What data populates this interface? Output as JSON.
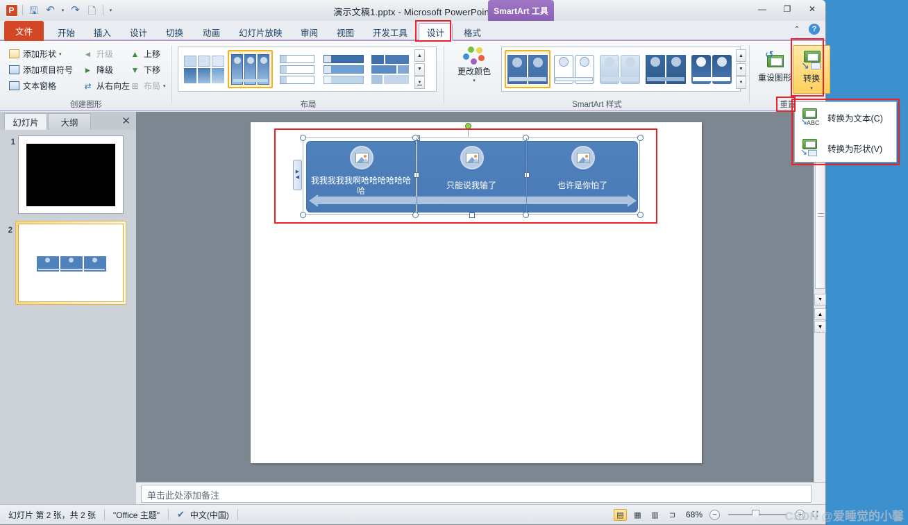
{
  "window": {
    "title": "演示文稿1.pptx  -  Microsoft PowerPoint",
    "context_tab_label": "SmartArt 工具",
    "minimize": "—",
    "restore": "❐",
    "close": "✕",
    "ribbon_collapse": "⌃",
    "help": "?"
  },
  "quick_access": {
    "logo": "P",
    "items": [
      {
        "name": "save-icon",
        "glyph": "🖫"
      },
      {
        "name": "undo-icon",
        "glyph": "↶"
      },
      {
        "name": "undo-dropdown-icon",
        "glyph": "▾"
      },
      {
        "name": "redo-icon",
        "glyph": "↷"
      },
      {
        "name": "new-icon",
        "glyph": "🗋"
      },
      {
        "name": "customize-qat-icon",
        "glyph": "▾"
      }
    ]
  },
  "tabs": [
    {
      "label": "文件",
      "kind": "file"
    },
    {
      "label": "开始"
    },
    {
      "label": "插入"
    },
    {
      "label": "设计"
    },
    {
      "label": "切换"
    },
    {
      "label": "动画"
    },
    {
      "label": "幻灯片放映"
    },
    {
      "label": "审阅"
    },
    {
      "label": "视图"
    },
    {
      "label": "开发工具"
    },
    {
      "label": "设计",
      "active": true,
      "highlighted": true
    },
    {
      "label": "格式"
    }
  ],
  "ribbon": {
    "groups": [
      {
        "name": "create-graphic",
        "label": "创建图形",
        "commands": [
          {
            "label": "添加形状",
            "icon": "add-shape-icon",
            "dropdown": true,
            "dimmed": false
          },
          {
            "label": "升级",
            "icon": "promote-icon",
            "dimmed": true
          },
          {
            "label": "上移",
            "icon": "move-up-icon",
            "dimmed": false
          },
          {
            "label": "添加项目符号",
            "icon": "add-bullet-icon",
            "dimmed": false
          },
          {
            "label": "降级",
            "icon": "demote-icon",
            "dimmed": false
          },
          {
            "label": "下移",
            "icon": "move-down-icon",
            "dimmed": false
          },
          {
            "label": "文本窗格",
            "icon": "text-pane-icon",
            "dimmed": false
          },
          {
            "label": "从右向左",
            "icon": "right-to-left-icon",
            "dimmed": false
          },
          {
            "label": "布局",
            "icon": "layout-icon",
            "dropdown": true,
            "dimmed": true
          }
        ]
      },
      {
        "name": "layouts",
        "label": "布局",
        "gallery_selected_index": 1,
        "scroll_up": "▲",
        "scroll_down": "▼",
        "more": "▼"
      },
      {
        "name": "smartart-styles",
        "label": "SmartArt 样式",
        "change_colors_label": "更改颜色",
        "gallery_selected_index": 0,
        "scroll_up": "▲",
        "scroll_down": "▼",
        "more": "▼"
      },
      {
        "name": "reset",
        "label": "重置",
        "buttons": [
          {
            "label": "重设图形",
            "icon": "reset-graphic-icon",
            "selected": false
          },
          {
            "label": "转换",
            "icon": "convert-icon",
            "selected": true,
            "dropdown": "▾"
          }
        ]
      }
    ]
  },
  "convert_menu": {
    "items": [
      {
        "label": "转换为文本(C)",
        "accel": "C",
        "icon": "convert-to-text-icon"
      },
      {
        "label": "转换为形状(V)",
        "accel": "V",
        "icon": "convert-to-shapes-icon"
      }
    ]
  },
  "left_panel": {
    "tabs": [
      {
        "label": "幻灯片",
        "active": true
      },
      {
        "label": "大纲",
        "active": false
      }
    ],
    "close_label": "✕",
    "slides": [
      {
        "number": "1",
        "selected": false,
        "content": "black"
      },
      {
        "number": "2",
        "selected": true,
        "content": "smartart"
      }
    ]
  },
  "slide": {
    "smartart": {
      "nodes": [
        {
          "text": "我我我我我啊哈哈哈哈哈哈哈",
          "icon": "picture-placeholder-icon"
        },
        {
          "text": "只能说我输了",
          "icon": "picture-placeholder-icon"
        },
        {
          "text": "也许是你怕了",
          "icon": "picture-placeholder-icon"
        }
      ],
      "text_pane_toggle": {
        "open_arrow": "▶",
        "close_arrow": "◀"
      }
    }
  },
  "notes": {
    "placeholder": "单击此处添加备注"
  },
  "status_bar": {
    "slide_indicator": "幻灯片 第 2 张，共 2 张",
    "theme": "\"Office 主题\"",
    "spellcheck_icon": "spellcheck-icon",
    "language": "中文(中国)",
    "views": [
      {
        "name": "normal-view-button",
        "glyph": "▤",
        "selected": true
      },
      {
        "name": "slide-sorter-button",
        "glyph": "▦",
        "selected": false
      },
      {
        "name": "reading-view-button",
        "glyph": "▥",
        "selected": false
      },
      {
        "name": "slideshow-button",
        "glyph": "⊐",
        "selected": false
      }
    ],
    "zoom_level": "68%",
    "zoom_out": "−",
    "zoom_in": "+",
    "watermark": "CSDN @爱睡觉的小馨"
  },
  "colors": {
    "accent_blue": "#4f81bd",
    "file_tab_red": "#d24726",
    "context_purple": "#8b5fb5",
    "highlight_red": "#e8232a",
    "selection_gold": "#f0b323",
    "desktop_blue": "#3d90ce"
  }
}
